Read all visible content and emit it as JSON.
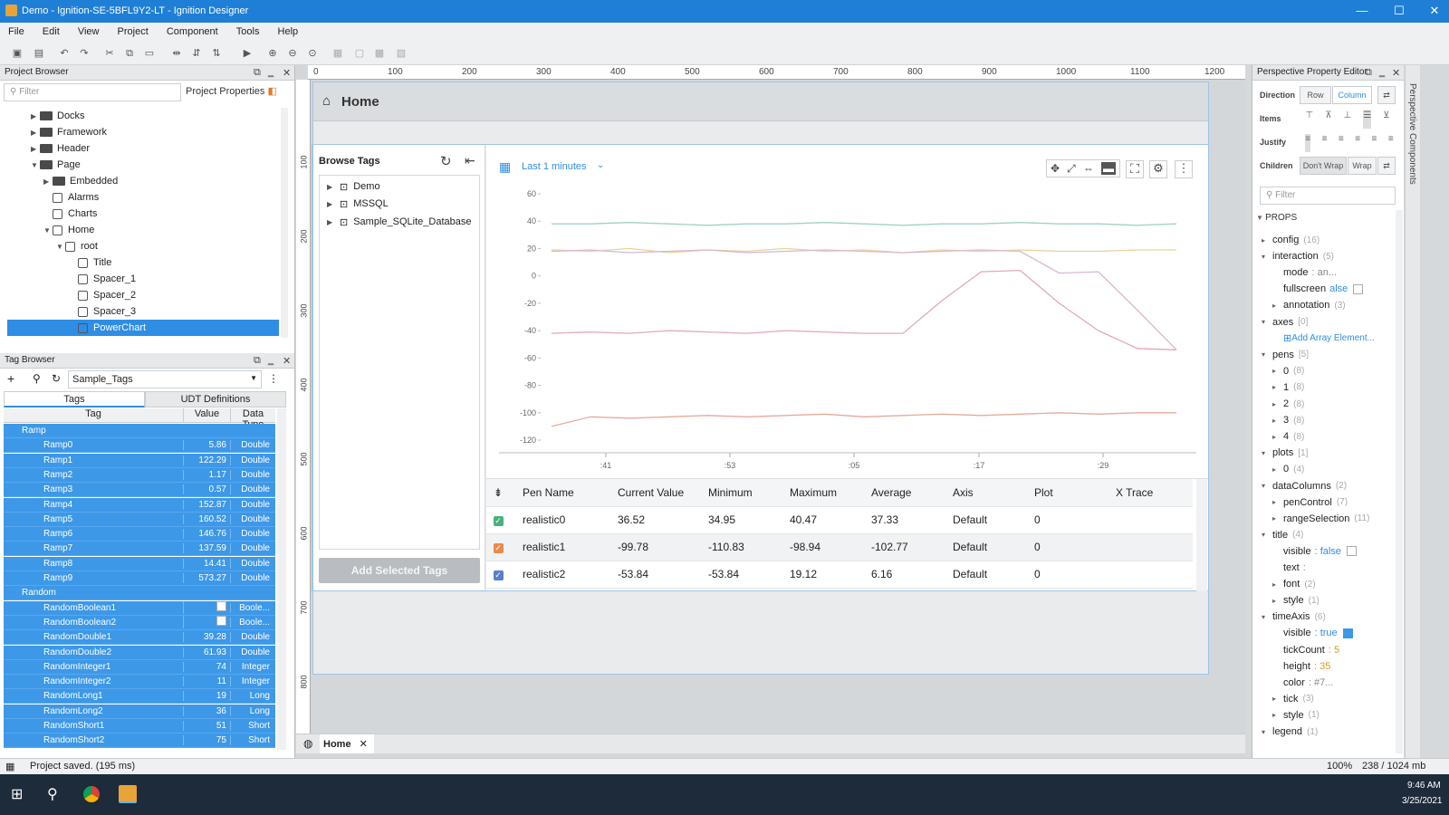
{
  "window": {
    "title": "Demo - Ignition-SE-5BFL9Y2-LT - Ignition Designer",
    "min": "—",
    "max": "☐",
    "close": "✕"
  },
  "menu": [
    "File",
    "Edit",
    "View",
    "Project",
    "Component",
    "Tools",
    "Help"
  ],
  "project_browser": {
    "title": "Project Browser",
    "filter_placeholder": "Filter",
    "properties_label": "Project Properties",
    "items": [
      {
        "label": "Docks",
        "type": "folder",
        "depth": 1,
        "expanded": false
      },
      {
        "label": "Framework",
        "type": "folder",
        "depth": 1,
        "expanded": false
      },
      {
        "label": "Header",
        "type": "folder",
        "depth": 1,
        "expanded": false
      },
      {
        "label": "Page",
        "type": "folder",
        "depth": 1,
        "expanded": true
      },
      {
        "label": "Embedded",
        "type": "folder",
        "depth": 2,
        "expanded": false
      },
      {
        "label": "Alarms",
        "type": "view",
        "depth": 2
      },
      {
        "label": "Charts",
        "type": "view",
        "depth": 2
      },
      {
        "label": "Home",
        "type": "view",
        "depth": 2,
        "expanded": true
      },
      {
        "label": "root",
        "type": "container",
        "depth": 3,
        "expanded": true
      },
      {
        "label": "Title",
        "type": "component",
        "depth": 4
      },
      {
        "label": "Spacer_1",
        "type": "component",
        "depth": 4
      },
      {
        "label": "Spacer_2",
        "type": "component",
        "depth": 4
      },
      {
        "label": "Spacer_3",
        "type": "component",
        "depth": 4
      },
      {
        "label": "PowerChart",
        "type": "component",
        "depth": 4,
        "selected": true
      }
    ]
  },
  "tag_browser": {
    "title": "Tag Browser",
    "provider": "Sample_Tags",
    "tabs": [
      "Tags",
      "UDT Definitions"
    ],
    "columns": [
      "Tag",
      "Value",
      "Data Type"
    ],
    "rows": [
      {
        "name": "Ramp",
        "group": true
      },
      {
        "name": "Ramp0",
        "value": "5.86",
        "type": "Double"
      },
      {
        "name": "Ramp1",
        "value": "122.29",
        "type": "Double"
      },
      {
        "name": "Ramp2",
        "value": "1.17",
        "type": "Double"
      },
      {
        "name": "Ramp3",
        "value": "0.57",
        "type": "Double",
        "alarm": true
      },
      {
        "name": "Ramp4",
        "value": "152.87",
        "type": "Double"
      },
      {
        "name": "Ramp5",
        "value": "160.52",
        "type": "Double"
      },
      {
        "name": "Ramp6",
        "value": "146.76",
        "type": "Double"
      },
      {
        "name": "Ramp7",
        "value": "137.59",
        "type": "Double"
      },
      {
        "name": "Ramp8",
        "value": "14.41",
        "type": "Double"
      },
      {
        "name": "Ramp9",
        "value": "573.27",
        "type": "Double"
      },
      {
        "name": "Random",
        "group": true
      },
      {
        "name": "RandomBoolean1",
        "value": "",
        "type": "Boole...",
        "bool": true
      },
      {
        "name": "RandomBoolean2",
        "value": "",
        "type": "Boole...",
        "bool": true
      },
      {
        "name": "RandomDouble1",
        "value": "39.28",
        "type": "Double"
      },
      {
        "name": "RandomDouble2",
        "value": "61.93",
        "type": "Double"
      },
      {
        "name": "RandomInteger1",
        "value": "74",
        "type": "Integer"
      },
      {
        "name": "RandomInteger2",
        "value": "11",
        "type": "Integer"
      },
      {
        "name": "RandomLong1",
        "value": "19",
        "type": "Long"
      },
      {
        "name": "RandomLong2",
        "value": "36",
        "type": "Long"
      },
      {
        "name": "RandomShort1",
        "value": "51",
        "type": "Short"
      },
      {
        "name": "RandomShort2",
        "value": "75",
        "type": "Short"
      }
    ]
  },
  "ruler": {
    "top": [
      "0",
      "100",
      "200",
      "300",
      "400",
      "500",
      "600",
      "700",
      "800",
      "900",
      "1000",
      "1100",
      "1200"
    ],
    "left": [
      "100",
      "200",
      "300",
      "400",
      "500",
      "600",
      "700",
      "800"
    ]
  },
  "view": {
    "home_title": "Home",
    "browse_tags": {
      "title": "Browse Tags",
      "items": [
        "Demo",
        "MSSQL",
        "Sample_SQLite_Database"
      ],
      "add_button": "Add Selected Tags"
    },
    "range_label": "Last 1 minutes",
    "pen_table": {
      "columns": [
        "Pen Name",
        "Current Value",
        "Minimum",
        "Maximum",
        "Average",
        "Axis",
        "Plot",
        "X Trace"
      ],
      "rows": [
        {
          "name": "realistic0",
          "current": "36.52",
          "min": "34.95",
          "max": "40.47",
          "avg": "37.33",
          "axis": "Default",
          "plot": "0",
          "color": "#4caf80"
        },
        {
          "name": "realistic1",
          "current": "-99.78",
          "min": "-110.83",
          "max": "-98.94",
          "avg": "-102.77",
          "axis": "Default",
          "plot": "0",
          "color": "#e88a4a"
        },
        {
          "name": "realistic2",
          "current": "-53.84",
          "min": "-53.84",
          "max": "19.12",
          "avg": "6.16",
          "axis": "Default",
          "plot": "0",
          "color": "#5a7ec8"
        }
      ]
    }
  },
  "chart_data": {
    "type": "line",
    "ylim": [
      -120,
      60
    ],
    "yticks": [
      "60",
      "40",
      "20",
      "0",
      "-20",
      "-40",
      "-60",
      "-80",
      "-100",
      "-120"
    ],
    "xticks": [
      ":41",
      ":53",
      ":05",
      ":17",
      ":29"
    ],
    "series": [
      {
        "color": "#9fd3c0",
        "values": [
          38,
          38,
          39,
          38,
          37,
          38,
          38,
          39,
          38,
          37,
          38,
          38,
          39,
          38,
          38,
          37,
          38
        ]
      },
      {
        "color": "#e6d39a",
        "values": [
          19,
          18,
          20,
          17,
          19,
          18,
          20,
          18,
          19,
          17,
          19,
          18,
          19,
          18,
          18,
          19,
          19
        ]
      },
      {
        "color": "#d8b7cf",
        "values": [
          18,
          19,
          17,
          18,
          19,
          17,
          18,
          19,
          18,
          17,
          18,
          19,
          18,
          2,
          3,
          -25,
          -54
        ]
      },
      {
        "color": "#e3a8b5",
        "values": [
          -42,
          -41,
          -42,
          -40,
          -41,
          -42,
          -40,
          -41,
          -42,
          -42,
          -18,
          3,
          4,
          -20,
          -40,
          -53,
          -54
        ]
      },
      {
        "color": "#e8a99b",
        "values": [
          -110,
          -103,
          -104,
          -103,
          -102,
          -103,
          -102,
          -101,
          -103,
          -102,
          -101,
          -102,
          -101,
          -100,
          -101,
          -100,
          -100
        ]
      }
    ]
  },
  "canvas_tab": "Home",
  "property_editor": {
    "title": "Perspective Property Editor",
    "side_label": "Perspective Components",
    "direction": {
      "label": "Direction",
      "options": [
        "Row",
        "Column"
      ]
    },
    "items_label": "Items",
    "justify_label": "Justify",
    "children": {
      "label": "Children",
      "options": [
        "Don't Wrap",
        "Wrap"
      ]
    },
    "filter_placeholder": "Filter",
    "section": "PROPS",
    "rows": [
      {
        "k": "config",
        "c": "(16)",
        "d": 1,
        "arrow": "▸"
      },
      {
        "k": "interaction",
        "c": "(5)",
        "d": 1,
        "arrow": "▾"
      },
      {
        "k": "mode",
        "v": ": an...",
        "d": 2
      },
      {
        "k": "fullscreen",
        "v": "alse",
        "d": 2,
        "cb": false
      },
      {
        "k": "annotation",
        "c": "(3)",
        "d": 2,
        "arrow": "▸"
      },
      {
        "k": "axes",
        "c": "[0]",
        "d": 1,
        "arrow": "▾"
      },
      {
        "k": "",
        "v": "Add Array Element...",
        "d": 2,
        "link": true
      },
      {
        "k": "pens",
        "c": "[5]",
        "d": 1,
        "arrow": "▾"
      },
      {
        "k": "0",
        "c": "(8)",
        "d": 2,
        "arrow": "▸"
      },
      {
        "k": "1",
        "c": "(8)",
        "d": 2,
        "arrow": "▸"
      },
      {
        "k": "2",
        "c": "(8)",
        "d": 2,
        "arrow": "▸"
      },
      {
        "k": "3",
        "c": "(8)",
        "d": 2,
        "arrow": "▸"
      },
      {
        "k": "4",
        "c": "(8)",
        "d": 2,
        "arrow": "▸"
      },
      {
        "k": "plots",
        "c": "[1]",
        "d": 1,
        "arrow": "▾"
      },
      {
        "k": "0",
        "c": "(4)",
        "d": 2,
        "arrow": "▸"
      },
      {
        "k": "dataColumns",
        "c": "(2)",
        "d": 1,
        "arrow": "▾"
      },
      {
        "k": "penControl",
        "c": "(7)",
        "d": 2,
        "arrow": "▸"
      },
      {
        "k": "rangeSelection",
        "c": "(11)",
        "d": 2,
        "arrow": "▸"
      },
      {
        "k": "title",
        "c": "(4)",
        "d": 1,
        "arrow": "▾"
      },
      {
        "k": "visible",
        "v": ": false",
        "d": 2,
        "cb": false
      },
      {
        "k": "text",
        "v": ":",
        "d": 2
      },
      {
        "k": "font",
        "c": "(2)",
        "d": 2,
        "arrow": "▸"
      },
      {
        "k": "style",
        "c": "(1)",
        "d": 2,
        "arrow": "▸"
      },
      {
        "k": "timeAxis",
        "c": "(6)",
        "d": 1,
        "arrow": "▾"
      },
      {
        "k": "visible",
        "v": ": true",
        "d": 2,
        "cb": true
      },
      {
        "k": "tickCount",
        "v": ": 5",
        "d": 2
      },
      {
        "k": "height",
        "v": ": 35",
        "d": 2
      },
      {
        "k": "color",
        "v": ": #7...",
        "d": 2
      },
      {
        "k": "tick",
        "c": "(3)",
        "d": 2,
        "arrow": "▸"
      },
      {
        "k": "style",
        "c": "(1)",
        "d": 2,
        "arrow": "▸"
      },
      {
        "k": "legend",
        "c": "(1)",
        "d": 1,
        "arrow": "▾"
      }
    ]
  },
  "status": {
    "message": "Project saved. (195 ms)",
    "zoom": "100%",
    "memory": "238 / 1024 mb"
  },
  "taskbar": {
    "time": "9:46 AM",
    "date": "3/25/2021"
  }
}
